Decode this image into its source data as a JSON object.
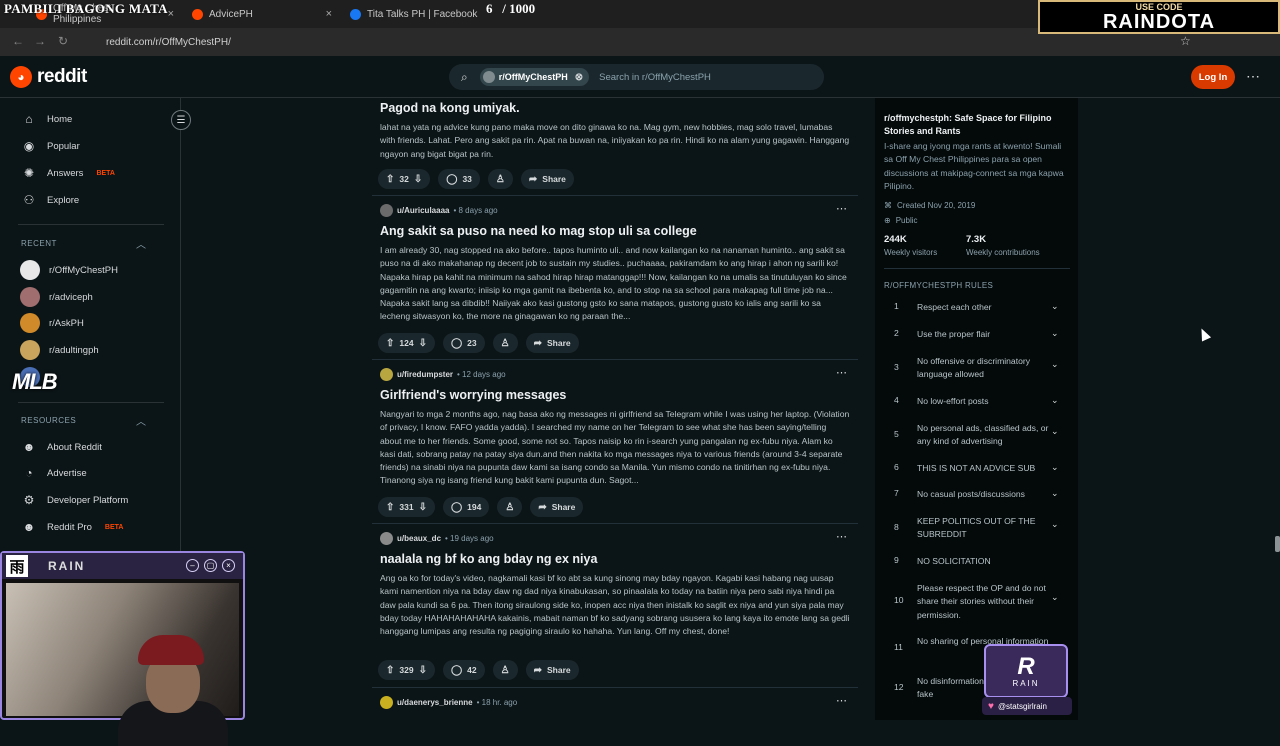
{
  "overlay": {
    "title": "PAMBILI BAGONG MATA",
    "counter_current": "6",
    "counter_total": "/ 1000"
  },
  "promo": {
    "small": "USE CODE",
    "big": "RAINDOTA"
  },
  "browser": {
    "tabs": [
      {
        "label": "Off My Chest Philippines",
        "color": "#ff4500"
      },
      {
        "label": "AdvicePH",
        "color": "#ff4500"
      },
      {
        "label": "Tita Talks PH | Facebook",
        "color": "#1877f2"
      }
    ],
    "url": "reddit.com/r/OffMyChestPH/"
  },
  "header": {
    "logo": "reddit",
    "search_chip": "r/OffMyChestPH",
    "search_placeholder": "Search in r/OffMyChestPH",
    "login": "Log In"
  },
  "sidebar": {
    "nav": [
      {
        "label": "Home",
        "icon": "home-icon",
        "glyph": "⌂"
      },
      {
        "label": "Popular",
        "icon": "popular-icon",
        "glyph": "◉"
      },
      {
        "label": "Answers",
        "icon": "answers-icon",
        "glyph": "✺",
        "badge": "BETA"
      },
      {
        "label": "Explore",
        "icon": "explore-icon",
        "glyph": "⚇"
      }
    ],
    "recent_head": "RECENT",
    "recent": [
      {
        "label": "r/OffMyChestPH",
        "color": "#e8e8e8"
      },
      {
        "label": "r/adviceph",
        "color": "#a06e6e"
      },
      {
        "label": "r/AskPH",
        "color": "#d08a2a"
      },
      {
        "label": "r/adultingph",
        "color": "#c9a45c"
      },
      {
        "label": "r/",
        "color": "#4a6fb5"
      }
    ],
    "resources_head": "RESOURCES",
    "resources": [
      {
        "label": "About Reddit",
        "icon": "reddit-icon",
        "glyph": "☻"
      },
      {
        "label": "Advertise",
        "icon": "advertise-icon",
        "glyph": "◔"
      },
      {
        "label": "Developer Platform",
        "icon": "developer-icon",
        "glyph": "⚙"
      },
      {
        "label": "Reddit Pro",
        "icon": "reddit-pro-icon",
        "glyph": "☻",
        "badge": "BETA"
      }
    ],
    "mlb": "MLB"
  },
  "posts": [
    {
      "title": "Pagod na kong umiyak.",
      "body": "lahat na yata ng advice kung pano maka move on dito ginawa ko na. Mag gym, new hobbies, mag solo travel, lumabas with friends. Lahat. Pero ang sakit pa rin. Apat na buwan na, iniiyakan ko pa rin. Hindi ko na alam yung gagawin. Hanggang ngayon ang bigat bigat pa rin.",
      "votes": "32",
      "comments": "33",
      "share": "Share"
    },
    {
      "user": "u/Auriculaaaa",
      "time": "• 8 days ago",
      "avatar": "#6b6b6b",
      "title": "Ang sakit sa puso na need ko mag stop uli sa college",
      "body": "I am already 30, nag stopped na ako before.. tapos huminto uli.. and now kailangan ko na nanaman huminto.. ang sakit sa puso na di ako makahanap ng decent job to sustain my studies.. puchaaaa, pakiramdam ko ang hirap i ahon ng sarili ko! Napaka hirap pa kahit na minimum na sahod hirap hirap matanggap!!! Now, kailangan ko na umalis sa tinutuluyan ko since gagamitin na ang kwarto; iniisip ko mga gamit na ibebenta ko, and to stop na sa school para makapag full time job na... Napaka sakit lang sa dibdib!! Naiiyak ako kasi gustong gsto ko sana matapos, gustong gusto ko ialis ang sarili ko sa lecheng sitwasyon ko, the more na ginagawan ko ng paraan the...",
      "votes": "124",
      "comments": "23",
      "share": "Share"
    },
    {
      "user": "u/firedumpster",
      "time": "• 12 days ago",
      "avatar": "#b8a640",
      "title": "Girlfriend's worrying messages",
      "body": "Nangyari to mga 2 months ago, nag basa ako ng messages ni girlfriend sa Telegram while I was using her laptop. (Violation of privacy, I know. FAFO yadda yadda). I searched my name on her Telegram to see what she has been saying/telling about me to her friends. Some good, some not so. Tapos naisip ko rin i-search yung pangalan ng ex-fubu niya. Alam ko kasi dati, sobrang patay na patay siya dun.and then nakita ko mga messages niya to various friends (around 3-4 separate friends) na sinabi niya na pupunta daw kami sa isang condo sa Manila. Yun mismo condo na tinitirhan ng ex-fubu niya. Tinanong siya ng isang friend kung bakit kami pupunta dun. Sagot...",
      "votes": "331",
      "comments": "194",
      "share": "Share"
    },
    {
      "user": "u/beaux_dc",
      "time": "• 19 days ago",
      "avatar": "#8a8a8a",
      "title": "naalala ng bf ko ang bday ng ex niya",
      "body": "Ang oa ko for today's video, nagkamali kasi bf ko abt sa kung sinong may bday ngayon. Kagabi kasi habang nag uusap kami namention niya na bday daw ng dad niya kinabukasan, so pinaalala ko today na batiin niya pero sabi niya hindi pa daw pala kundi sa 6 pa. Then itong siraulong side ko, inopen acc niya then inistalk ko saglit ex niya and yun siya pala may bday today HAHAHAHAHAHA kakainis, mabait naman bf ko sadyang sobrang ususera ko lang kaya ito emote lang sa gedli hanggang lumipas ang resulta ng pagiging siraulo ko hahaha. Yun lang. Off my chest, done!",
      "votes": "329",
      "comments": "42",
      "share": "Share"
    },
    {
      "user": "u/daenerys_brienne",
      "time": "• 18 hr. ago",
      "avatar": "#c8b020"
    }
  ],
  "about": {
    "title": "r/offmychestph: Safe Space for Filipino Stories and Rants",
    "desc": "I-share ang iyong mga rants at kwento! Sumali sa Off My Chest Philippines para sa open discussions at makipag-connect sa mga kapwa Pilipino.",
    "created": "Created Nov 20, 2019",
    "visibility": "Public",
    "visitors": "244K",
    "visitors_label": "Weekly visitors",
    "contributions": "7.3K",
    "contributions_label": "Weekly contributions"
  },
  "rules_head": "R/OFFMYCHESTPH RULES",
  "rules": [
    {
      "n": "1",
      "text": "Respect each other"
    },
    {
      "n": "2",
      "text": "Use the proper flair"
    },
    {
      "n": "3",
      "text": "No offensive or discriminatory language allowed"
    },
    {
      "n": "4",
      "text": "No low-effort posts"
    },
    {
      "n": "5",
      "text": "No personal ads, classified ads, or any kind of advertising"
    },
    {
      "n": "6",
      "text": "THIS IS NOT AN ADVICE SUB"
    },
    {
      "n": "7",
      "text": "No casual posts/discussions"
    },
    {
      "n": "8",
      "text": "KEEP POLITICS OUT OF THE SUBREDDIT"
    },
    {
      "n": "9",
      "text": "NO SOLICITATION"
    },
    {
      "n": "10",
      "text": "Please respect the OP and do not share their stories without their permission."
    },
    {
      "n": "11",
      "text": "No sharing of personal information"
    },
    {
      "n": "12",
      "text": "No disinformation or spreading of fake"
    }
  ],
  "webcam": {
    "logo": "雨",
    "name": "RAIN"
  },
  "rain_badge": {
    "mark": "R",
    "text": "RAIN",
    "social": "@statsgirlrain"
  }
}
